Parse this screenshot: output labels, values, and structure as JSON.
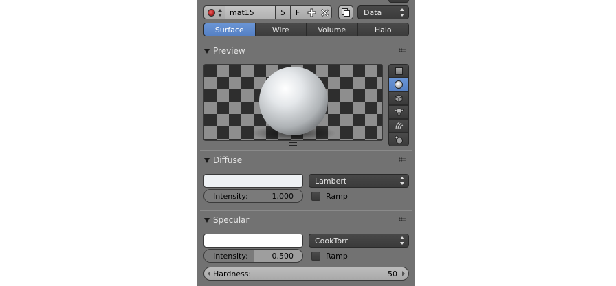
{
  "material_slot": {
    "name": "mat15",
    "users": "5",
    "fake_user": "F",
    "link": "Data"
  },
  "tabs": [
    {
      "label": "Surface",
      "active": true
    },
    {
      "label": "Wire",
      "active": false
    },
    {
      "label": "Volume",
      "active": false
    },
    {
      "label": "Halo",
      "active": false
    }
  ],
  "preview": {
    "title": "Preview",
    "shapes": [
      "plane-icon",
      "sphere-icon",
      "cube-icon",
      "monkey-icon",
      "hair-icon",
      "sphere-sky-icon"
    ],
    "active_shape": "sphere-icon"
  },
  "diffuse": {
    "title": "Diffuse",
    "color": "#eef1f4",
    "shader": "Lambert",
    "intensity_label": "Intensity:",
    "intensity": "1.000",
    "ramp_label": "Ramp"
  },
  "specular": {
    "title": "Specular",
    "color": "#ffffff",
    "shader": "CookTorr",
    "intensity_label": "Intensity:",
    "intensity": "0.500",
    "intensity_fraction": 0.5,
    "ramp_label": "Ramp",
    "hardness_label": "Hardness:",
    "hardness": "50"
  },
  "colors": {
    "panel_bg": "#727272",
    "accent": "#5680c2",
    "widget_dark": "#3f3f3f"
  }
}
